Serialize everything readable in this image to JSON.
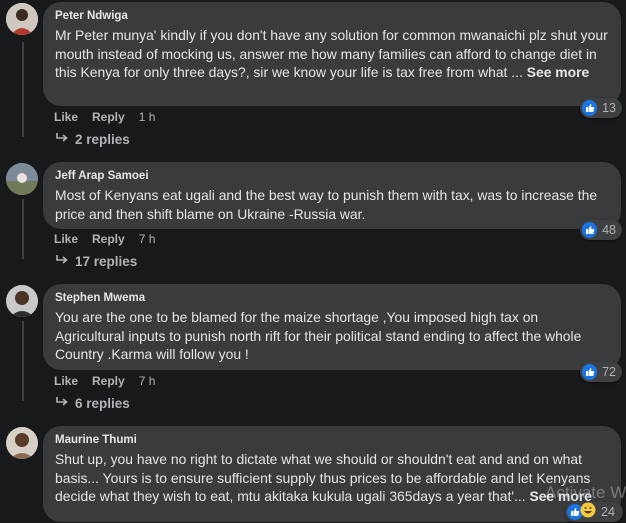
{
  "comments": [
    {
      "author": "Peter Ndwiga",
      "text": "Mr Peter munya' kindly if you don't have any solution for common mwanaichi plz shut your mouth instead of mocking us, answer me how many families can afford to change diet in this Kenya for only three days?, sir we know your life is tax free from what ...",
      "see_more": "See more",
      "reaction_count": "13",
      "like": "Like",
      "reply": "Reply",
      "time": "1 h",
      "replies": "2 replies"
    },
    {
      "author": "Jeff Arap Samoei",
      "text": "Most of Kenyans eat ugali and the best way to punish them with tax, was to increase the price and then shift blame on Ukraine -Russia war.",
      "reaction_count": "48",
      "like": "Like",
      "reply": "Reply",
      "time": "7 h",
      "replies": "17 replies"
    },
    {
      "author": "Stephen Mwema",
      "text": "You are the one to be blamed for the maize shortage ,You imposed high tax on Agricultural inputs to punish north rift for their political stand ending to affect the whole Country .Karma will follow you !",
      "reaction_count": "72",
      "like": "Like",
      "reply": "Reply",
      "time": "7 h",
      "replies": "6 replies"
    },
    {
      "author": "Maurine Thumi",
      "text": "Shut up, you have no right to dictate what we should or shouldn't eat and and on what basis... Yours is to ensure sufficient supply thus prices to be affordable and let Kenyans decide what they wish to eat, mtu akitaka kukula ugali 365days a year that'...",
      "see_more": "See more",
      "reaction_count": "24"
    }
  ],
  "watermark": "Activate Wi",
  "colors": {
    "background": "#18191a",
    "bubble": "#3a3b3c",
    "like_blue": "#1b74e4",
    "muted": "#b0b3b8"
  },
  "icons": {
    "reaction": "thumbs-up-icon",
    "reply_arrow": "reply-arrow-icon",
    "laugh": "laugh-emoji-icon"
  }
}
